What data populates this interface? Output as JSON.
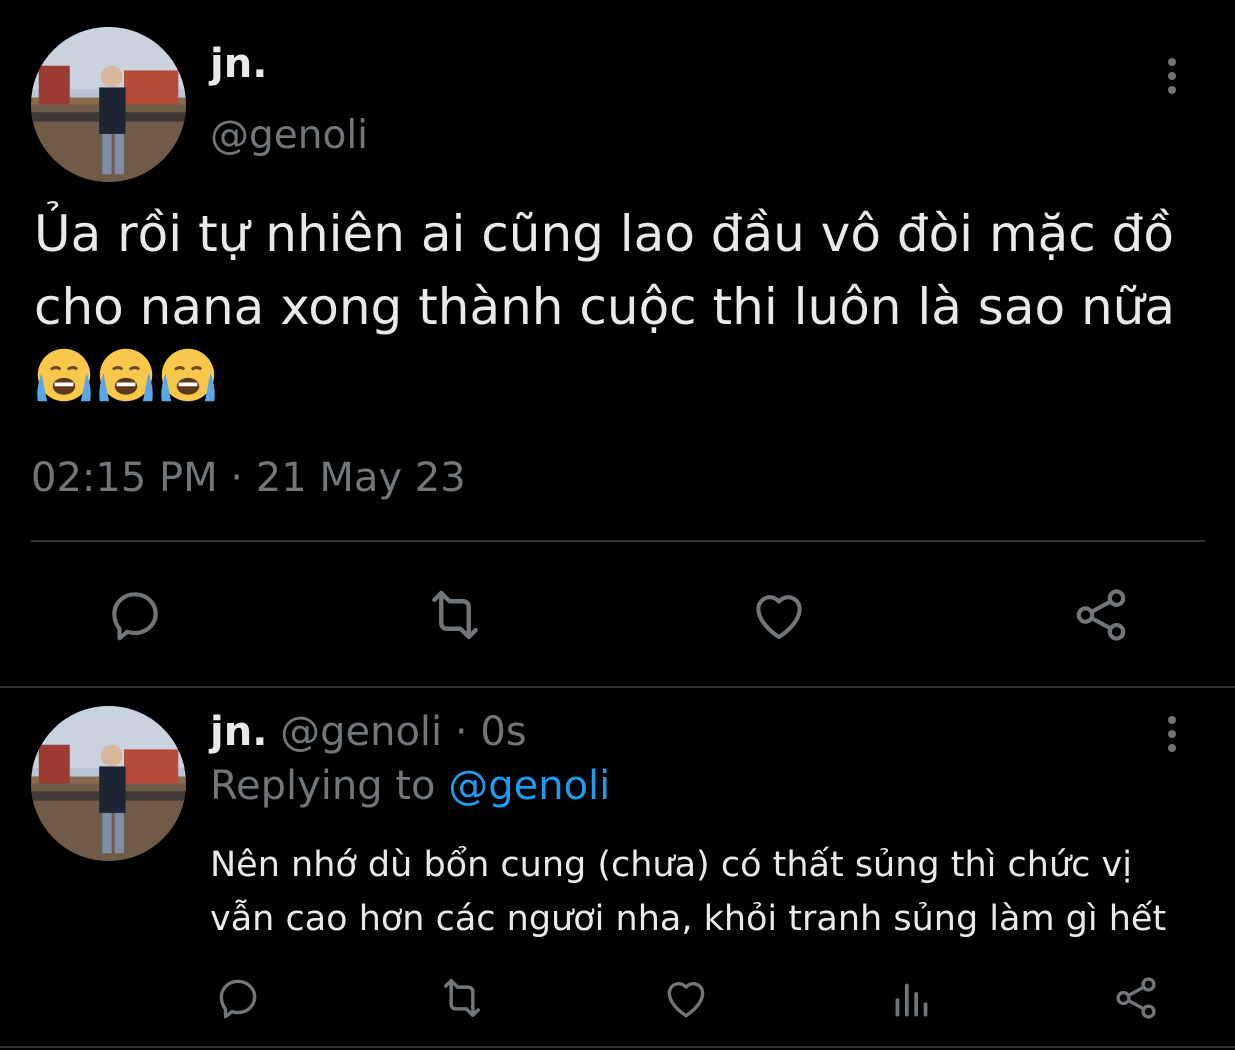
{
  "main_tweet": {
    "display_name": "jn.",
    "handle": "@genoli",
    "text": "Ủa rồi tự nhiên ai cũng lao đầu vô đòi mặc đồ cho nana xong thành cuộc thi luôn là sao nữa",
    "emoji": [
      "crying-face",
      "crying-face",
      "crying-face"
    ],
    "timestamp": "02:15 PM · 21 May 23",
    "actions": [
      "reply-icon",
      "retweet-icon",
      "like-icon",
      "share-icon"
    ]
  },
  "reply_tweet": {
    "display_name": "jn.",
    "handle": "@genoli",
    "separator": " · ",
    "time": "0s",
    "replying_prefix": "Replying to ",
    "replying_to": "@genoli",
    "text": "Nên nhớ dù bổn cung (chưa) có thất sủng thì chức vị vẫn cao hơn các ngươi nha, khỏi tranh sủng làm gì hết",
    "actions": [
      "reply-icon",
      "retweet-icon",
      "like-icon",
      "views-icon",
      "share-icon"
    ]
  },
  "colors": {
    "background": "#000000",
    "text": "#e7e9ea",
    "muted": "#71767b",
    "link": "#1d9bf0",
    "divider": "#2f3336"
  }
}
